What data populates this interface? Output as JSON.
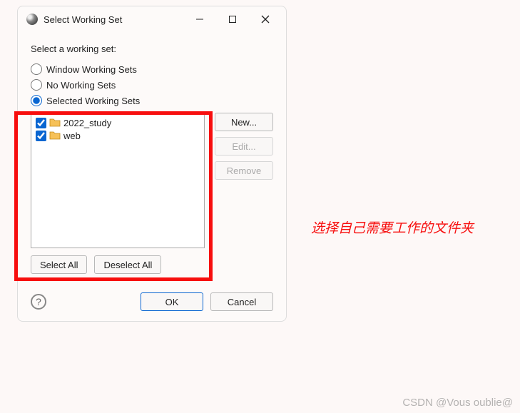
{
  "dialog": {
    "title": "Select Working Set",
    "prompt": "Select a working set:",
    "radios": [
      {
        "label": "Window Working Sets",
        "selected": false
      },
      {
        "label": "No Working Sets",
        "selected": false
      },
      {
        "label": "Selected Working Sets",
        "selected": true
      }
    ],
    "items": [
      {
        "label": "2022_study",
        "checked": true
      },
      {
        "label": "web",
        "checked": true
      }
    ],
    "buttons": {
      "new": "New...",
      "edit": "Edit...",
      "remove": "Remove",
      "selectAll": "Select All",
      "deselectAll": "Deselect All",
      "ok": "OK",
      "cancel": "Cancel"
    }
  },
  "annotation": "选择自己需要工作的文件夹",
  "watermark": "CSDN @Vous oublie@"
}
